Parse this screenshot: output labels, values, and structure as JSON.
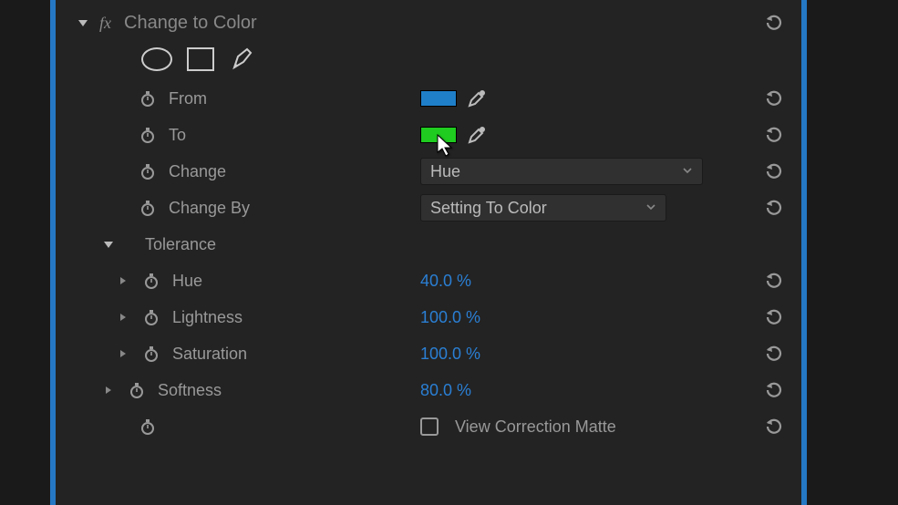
{
  "effect": {
    "title": "Change to Color",
    "params": {
      "from": {
        "label": "From",
        "color": "#1f7fc9"
      },
      "to": {
        "label": "To",
        "color": "#1fcc1f"
      },
      "change": {
        "label": "Change",
        "selected": "Hue"
      },
      "changeBy": {
        "label": "Change By",
        "selected": "Setting To Color"
      },
      "tolerance": {
        "label": "Tolerance",
        "hue": {
          "label": "Hue",
          "value": "40.0 %"
        },
        "lightness": {
          "label": "Lightness",
          "value": "100.0 %"
        },
        "saturation": {
          "label": "Saturation",
          "value": "100.0 %"
        }
      },
      "softness": {
        "label": "Softness",
        "value": "80.0 %"
      },
      "viewMatte": {
        "label": "View Correction Matte",
        "checked": false
      }
    }
  }
}
